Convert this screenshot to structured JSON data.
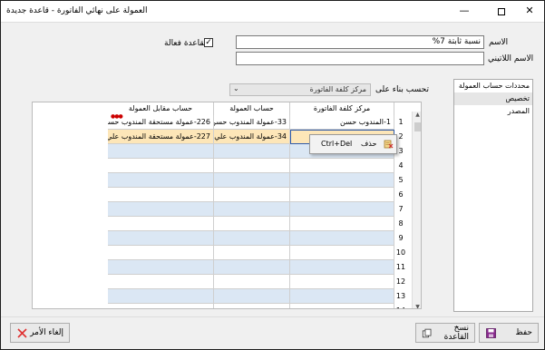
{
  "window": {
    "title": "العمولة على نهائي الفاتورة - قاعدة جديدة",
    "minimize": "—",
    "close": "✕"
  },
  "form": {
    "name_label": "الاسم",
    "name_value": "نسبة ثابتة 7%",
    "latin_name_label": "الاسم اللاتيني",
    "latin_name_value": "",
    "active_rule_label": "القاعدة فعالة",
    "active_rule_checked": "✓",
    "calc_based_on_label": "تحسب بناء على",
    "calc_based_on_value": "مركز كلفة الفاتورة"
  },
  "determinants": {
    "items": [
      "محددات حساب العمولة",
      "تخصيص",
      "المصدر"
    ]
  },
  "grid": {
    "headers": [
      "مركز كلفة الفاتورة",
      "حساب العمولة",
      "حساب مقابل العمولة"
    ],
    "rows": [
      {
        "num": "1",
        "cost_center": "1-المندوب حسن",
        "commission_account": "33-عمولة المندوب حسن",
        "counter_account": "226-عمولة مستحقة المندوب حسن"
      },
      {
        "num": "2",
        "cost_center": "",
        "commission_account": "34-عمولة المندوب علي",
        "counter_account": "227-عمولة مستحقة المندوب علي"
      },
      {
        "num": "3",
        "cost_center": "",
        "commission_account": "",
        "counter_account": ""
      },
      {
        "num": "4",
        "cost_center": "",
        "commission_account": "",
        "counter_account": ""
      },
      {
        "num": "5",
        "cost_center": "",
        "commission_account": "",
        "counter_account": ""
      },
      {
        "num": "6",
        "cost_center": "",
        "commission_account": "",
        "counter_account": ""
      },
      {
        "num": "7",
        "cost_center": "",
        "commission_account": "",
        "counter_account": ""
      },
      {
        "num": "8",
        "cost_center": "",
        "commission_account": "",
        "counter_account": ""
      },
      {
        "num": "9",
        "cost_center": "",
        "commission_account": "",
        "counter_account": ""
      },
      {
        "num": "10",
        "cost_center": "",
        "commission_account": "",
        "counter_account": ""
      },
      {
        "num": "11",
        "cost_center": "",
        "commission_account": "",
        "counter_account": ""
      },
      {
        "num": "12",
        "cost_center": "",
        "commission_account": "",
        "counter_account": ""
      },
      {
        "num": "13",
        "cost_center": "",
        "commission_account": "",
        "counter_account": ""
      },
      {
        "num": "14",
        "cost_center": "",
        "commission_account": "",
        "counter_account": ""
      }
    ]
  },
  "context_menu": {
    "item_label": "حذف",
    "item_shortcut": "Ctrl+Del"
  },
  "buttons": {
    "cancel": "إلغاء الأمر",
    "copy_rule": "نسخ القاعدة",
    "save": "حفظ"
  },
  "colors": {
    "selected_row": "#fde6b8",
    "empty_row": "#dbe7f4",
    "cancel_icon": "#e03030",
    "save_icon": "#8a2b8f"
  }
}
